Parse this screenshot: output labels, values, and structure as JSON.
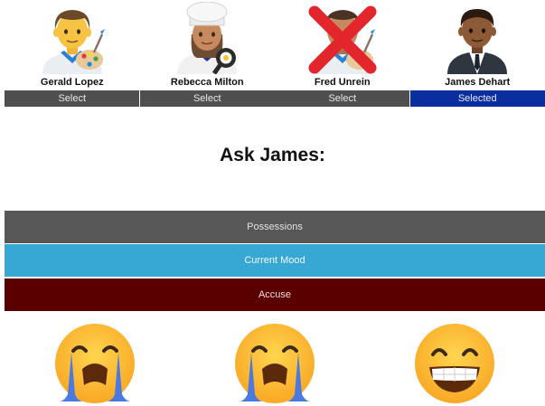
{
  "characters": [
    {
      "name": "Gerald Lopez",
      "button": "Select",
      "status": "default",
      "icon": "man-artist-icon"
    },
    {
      "name": "Rebecca Milton",
      "button": "Select",
      "status": "default",
      "icon": "woman-cook-icon"
    },
    {
      "name": "Fred Unrein",
      "button": "Select",
      "status": "eliminated",
      "icon": "man-artist-crossed-icon"
    },
    {
      "name": "James Dehart",
      "button": "Selected",
      "status": "selected",
      "icon": "man-in-suit-icon"
    }
  ],
  "ask": {
    "title": "Ask James:"
  },
  "actions": {
    "possessions": "Possessions",
    "mood": "Current Mood",
    "accuse": "Accuse"
  },
  "moods": [
    {
      "icon": "loudly-crying-face-icon"
    },
    {
      "icon": "loudly-crying-face-icon"
    },
    {
      "icon": "grinning-face-icon"
    }
  ],
  "colors": {
    "select_button": "#4f4f4f",
    "selected_button": "#0a2e9e",
    "possessions_button": "#575757",
    "mood_button": "#37a7d3",
    "accuse_button": "#5b0000",
    "cross": "#e2262c"
  }
}
